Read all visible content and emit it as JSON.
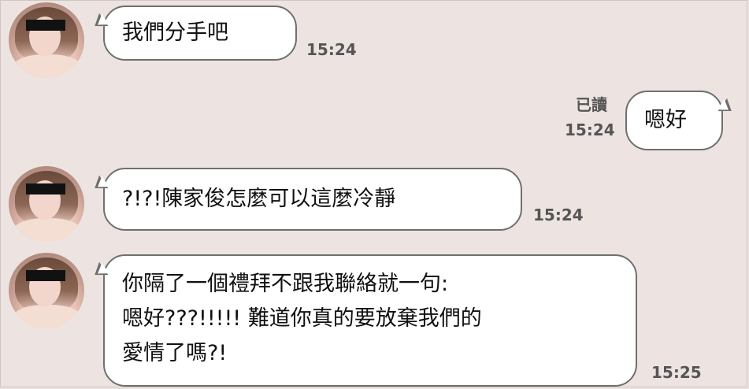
{
  "messages": [
    {
      "sender": "other",
      "text": "我們分手吧",
      "time": "15:24"
    },
    {
      "sender": "self",
      "text": "嗯好",
      "time": "15:24",
      "read_label": "已讀"
    },
    {
      "sender": "other",
      "text": "?!?!陳家俊怎麼可以這麼冷靜",
      "time": "15:24"
    },
    {
      "sender": "other",
      "text": "你隔了一個禮拜不跟我聯絡就一句:\n嗯好???!!!!! 難道你真的要放棄我們的\n愛情了嗎?!",
      "time": "15:25"
    }
  ],
  "colors": {
    "background": "#ede4e1",
    "bubble": "#ffffff",
    "bubble_border": "#6f6f6f",
    "timestamp": "#555555"
  }
}
